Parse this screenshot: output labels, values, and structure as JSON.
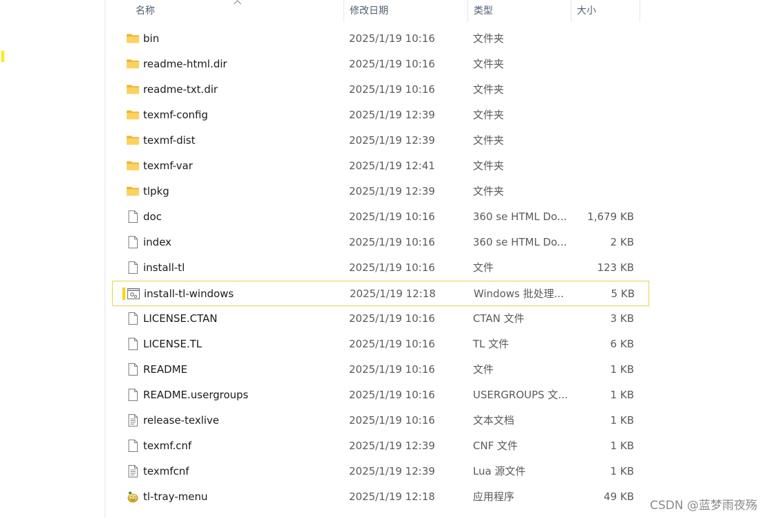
{
  "header": {
    "name": "名称",
    "date": "修改日期",
    "type": "类型",
    "size": "大小"
  },
  "colors": {
    "folder": "#f8c440",
    "selection_border": "#f2dc2c",
    "header_text": "#4c607a"
  },
  "files": [
    {
      "name": "bin",
      "date": "2025/1/19 10:16",
      "type": "文件夹",
      "size": "",
      "icon": "folder-icon"
    },
    {
      "name": "readme-html.dir",
      "date": "2025/1/19 10:16",
      "type": "文件夹",
      "size": "",
      "icon": "folder-icon"
    },
    {
      "name": "readme-txt.dir",
      "date": "2025/1/19 10:16",
      "type": "文件夹",
      "size": "",
      "icon": "folder-icon"
    },
    {
      "name": "texmf-config",
      "date": "2025/1/19 12:39",
      "type": "文件夹",
      "size": "",
      "icon": "folder-icon"
    },
    {
      "name": "texmf-dist",
      "date": "2025/1/19 12:39",
      "type": "文件夹",
      "size": "",
      "icon": "folder-icon"
    },
    {
      "name": "texmf-var",
      "date": "2025/1/19 12:41",
      "type": "文件夹",
      "size": "",
      "icon": "folder-icon"
    },
    {
      "name": "tlpkg",
      "date": "2025/1/19 12:39",
      "type": "文件夹",
      "size": "",
      "icon": "folder-icon"
    },
    {
      "name": "doc",
      "date": "2025/1/19 10:16",
      "type": "360 se HTML Do...",
      "size": "1,679 KB",
      "icon": "file-icon"
    },
    {
      "name": "index",
      "date": "2025/1/19 10:16",
      "type": "360 se HTML Do...",
      "size": "2 KB",
      "icon": "file-icon"
    },
    {
      "name": "install-tl",
      "date": "2025/1/19 10:16",
      "type": "文件",
      "size": "123 KB",
      "icon": "file-icon"
    },
    {
      "name": "install-tl-windows",
      "date": "2025/1/19 12:18",
      "type": "Windows 批处理...",
      "size": "5 KB",
      "icon": "batch-file-icon",
      "selected": true
    },
    {
      "name": "LICENSE.CTAN",
      "date": "2025/1/19 10:16",
      "type": "CTAN 文件",
      "size": "3 KB",
      "icon": "file-icon"
    },
    {
      "name": "LICENSE.TL",
      "date": "2025/1/19 10:16",
      "type": "TL 文件",
      "size": "6 KB",
      "icon": "file-icon"
    },
    {
      "name": "README",
      "date": "2025/1/19 10:16",
      "type": "文件",
      "size": "1 KB",
      "icon": "file-icon"
    },
    {
      "name": "README.usergroups",
      "date": "2025/1/19 10:16",
      "type": "USERGROUPS 文...",
      "size": "1 KB",
      "icon": "file-icon"
    },
    {
      "name": "release-texlive",
      "date": "2025/1/19 10:16",
      "type": "文本文档",
      "size": "1 KB",
      "icon": "text-file-icon"
    },
    {
      "name": "texmf.cnf",
      "date": "2025/1/19 12:39",
      "type": "CNF 文件",
      "size": "1 KB",
      "icon": "file-icon"
    },
    {
      "name": "texmfcnf",
      "date": "2025/1/19 12:39",
      "type": "Lua 源文件",
      "size": "1 KB",
      "icon": "text-file-icon"
    },
    {
      "name": "tl-tray-menu",
      "date": "2025/1/19 12:18",
      "type": "应用程序",
      "size": "49 KB",
      "icon": "app-icon"
    }
  ],
  "watermark": "CSDN @蓝梦雨夜殇"
}
